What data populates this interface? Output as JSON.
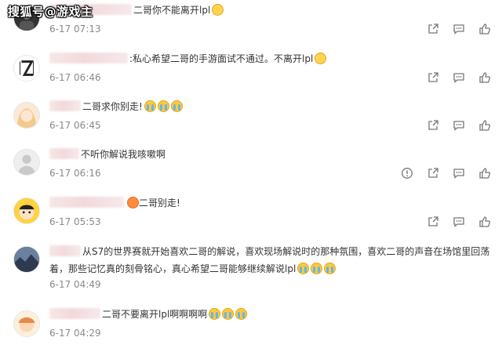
{
  "watermark": "搜狐号@游戏主",
  "comments": [
    {
      "text": "二哥你不能离开lpl",
      "emoji": [
        "sad"
      ],
      "time": "6-17 07:13",
      "report": false
    },
    {
      "text": ":私心希望二哥的手游面试不通过。不离开lpl",
      "emoji": [
        "sad"
      ],
      "time": "6-17 06:46",
      "report": false
    },
    {
      "text": "二哥求你别走!",
      "emoji": [
        "cry",
        "cry",
        "cry"
      ],
      "time": "6-17 06:45",
      "report": false
    },
    {
      "text": "不听你解说我咳嗽啊",
      "emoji": [],
      "time": "6-17 06:16",
      "report": true
    },
    {
      "text": "二哥别走!",
      "emoji": [
        "red"
      ],
      "time": "6-17 05:53",
      "report": false
    },
    {
      "text": "从S7的世界赛就开始喜欢二哥的解说，喜欢现场解说时的那种氛围，喜欢二哥的声音在场馆里回荡着，那些记忆真的刻骨铭心，真心希望二哥能够继续解说lpl",
      "emoji": [
        "cry",
        "cry",
        "cry"
      ],
      "time": "6-17 04:49",
      "report": false
    },
    {
      "text": "二哥不要离开lpl啊啊啊啊",
      "emoji": [
        "cry",
        "cry",
        "cry"
      ],
      "time": "6-17 04:29",
      "report": false
    }
  ],
  "icons": [
    "share-icon",
    "comment-icon",
    "like-icon",
    "report-icon"
  ]
}
